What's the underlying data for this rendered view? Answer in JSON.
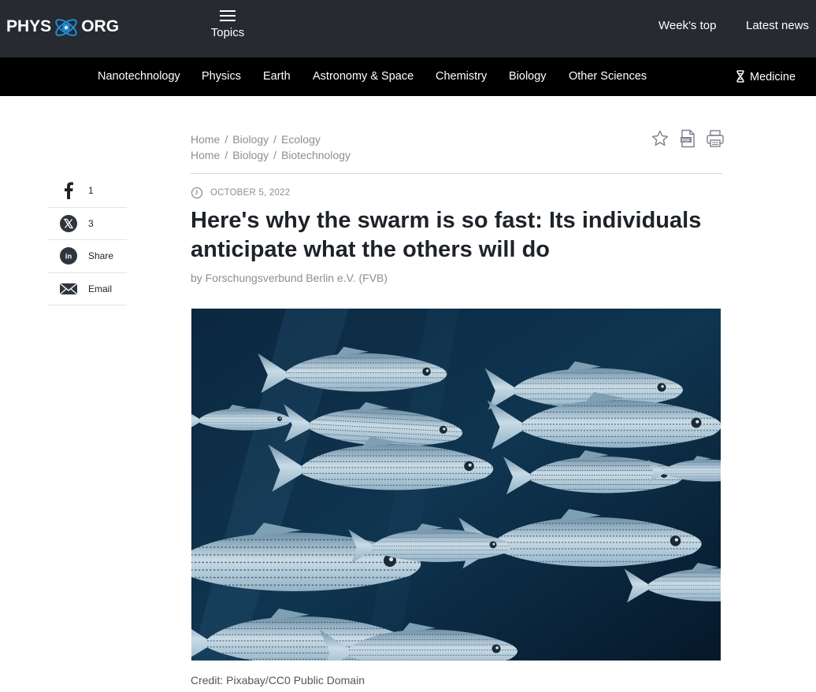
{
  "header": {
    "logo_left": "PHYS",
    "logo_right": "ORG",
    "topics_label": "Topics",
    "weeks_top": "Week's top",
    "latest_news": "Latest news"
  },
  "nav": {
    "items": [
      "Nanotechnology",
      "Physics",
      "Earth",
      "Astronomy & Space",
      "Chemistry",
      "Biology",
      "Other Sciences"
    ],
    "medicine": "Medicine"
  },
  "share": {
    "facebook_count": "1",
    "x_count": "3",
    "linkedin_label": "Share",
    "email_label": "Email"
  },
  "breadcrumbs": [
    [
      "Home",
      "Biology",
      "Ecology"
    ],
    [
      "Home",
      "Biology",
      "Biotechnology"
    ]
  ],
  "article": {
    "date": "OCTOBER 5, 2022",
    "title": "Here's why the swarm is so fast: Its individuals anticipate what the others will do",
    "byline": "by Forschungsverbund Berlin e.V. (FVB)",
    "credit": "Credit: Pixabay/CC0 Public Domain"
  },
  "icons": {
    "share": [
      "facebook-icon",
      "x-icon",
      "linkedin-icon",
      "email-icon"
    ],
    "tools": [
      "star-icon",
      "pdf-icon",
      "print-icon"
    ]
  },
  "colors": {
    "header_bg": "#272a31",
    "nav_bg": "#000000",
    "muted_text": "#8a8e96",
    "headline": "#1e2229"
  }
}
